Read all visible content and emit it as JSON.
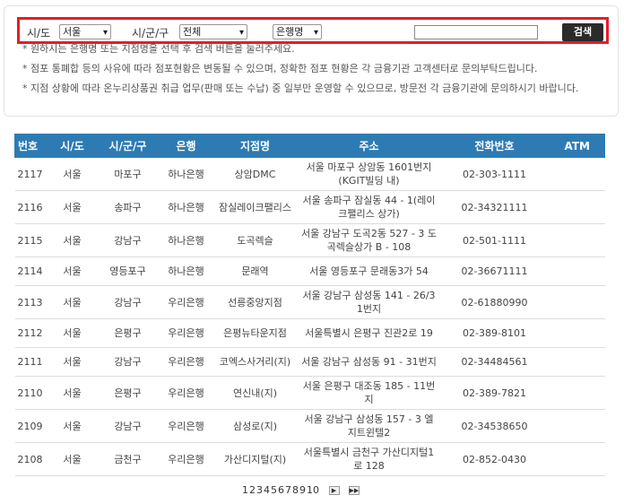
{
  "filters": {
    "sido_label": "시/도",
    "sido_value": "서울",
    "sigungu_label": "시/군/구",
    "sigungu_value": "전체",
    "type_value": "은행명",
    "search_button": "검색"
  },
  "notes": [
    "* 원하시는 은행명 또는 지점명을 선택 후 검색 버튼을 눌러주세요.",
    "* 점포 통폐합 등의 사유에 따라 점포현황은 변동될 수 있으며, 정확한 점포 현황은 각 금융기관 고객센터로 문의부탁드립니다.",
    "* 지점 상황에 따라 온누리상품권 취급 업무(판매 또는 수납) 중 일부만 운영할 수 있으므로, 방문전 각 금융기관에 문의하시기 바랍니다."
  ],
  "table": {
    "headers": [
      "번호",
      "시/도",
      "시/군/구",
      "은행",
      "지점명",
      "주소",
      "전화번호",
      "ATM"
    ],
    "rows": [
      [
        "2117",
        "서울",
        "마포구",
        "하나은행",
        "상암DMC",
        "서울 마포구 상암동 1601번지 (KGIT빌딩 내)",
        "02-303-1111",
        ""
      ],
      [
        "2116",
        "서울",
        "송파구",
        "하나은행",
        "잠실레이크팰리스",
        "서울 송파구 잠실동 44 - 1(레이크팰리스 상가)",
        "02-34321111",
        ""
      ],
      [
        "2115",
        "서울",
        "강남구",
        "하나은행",
        "도곡렉슬",
        "서울 강남구 도곡2동 527 - 3 도곡렉슬상가 B - 108",
        "02-501-1111",
        ""
      ],
      [
        "2114",
        "서울",
        "영등포구",
        "하나은행",
        "문래역",
        "서울 영등포구 문래동3가 54",
        "02-36671111",
        ""
      ],
      [
        "2113",
        "서울",
        "강남구",
        "우리은행",
        "선릉중앙지점",
        "서울 강남구 삼성동 141 - 26/31번지",
        "02-61880990",
        ""
      ],
      [
        "2112",
        "서울",
        "은평구",
        "우리은행",
        "은평뉴타운지점",
        "서울특별시 은평구 진관2로 19",
        "02-389-8101",
        ""
      ],
      [
        "2111",
        "서울",
        "강남구",
        "우리은행",
        "코엑스사거리(지)",
        "서울 강남구 삼성동 91 - 31번지",
        "02-34484561",
        ""
      ],
      [
        "2110",
        "서울",
        "은평구",
        "우리은행",
        "연신내(지)",
        "서울 은평구 대조동 185 - 11번지",
        "02-389-7821",
        ""
      ],
      [
        "2109",
        "서울",
        "강남구",
        "우리은행",
        "삼성로(지)",
        "서울 강남구 삼성동 157 - 3 엘지트윈텔2",
        "02-34538650",
        ""
      ],
      [
        "2108",
        "서울",
        "금천구",
        "우리은행",
        "가산디지털(지)",
        "서울특별시 금천구 가산디지털1로 128",
        "02-852-0430",
        ""
      ]
    ]
  },
  "pagination": {
    "pages": [
      "1",
      "2",
      "3",
      "4",
      "5",
      "6",
      "7",
      "8",
      "9",
      "10"
    ],
    "next_icon": "next-arrow-icon",
    "last_icon": "last-arrow-icon"
  }
}
